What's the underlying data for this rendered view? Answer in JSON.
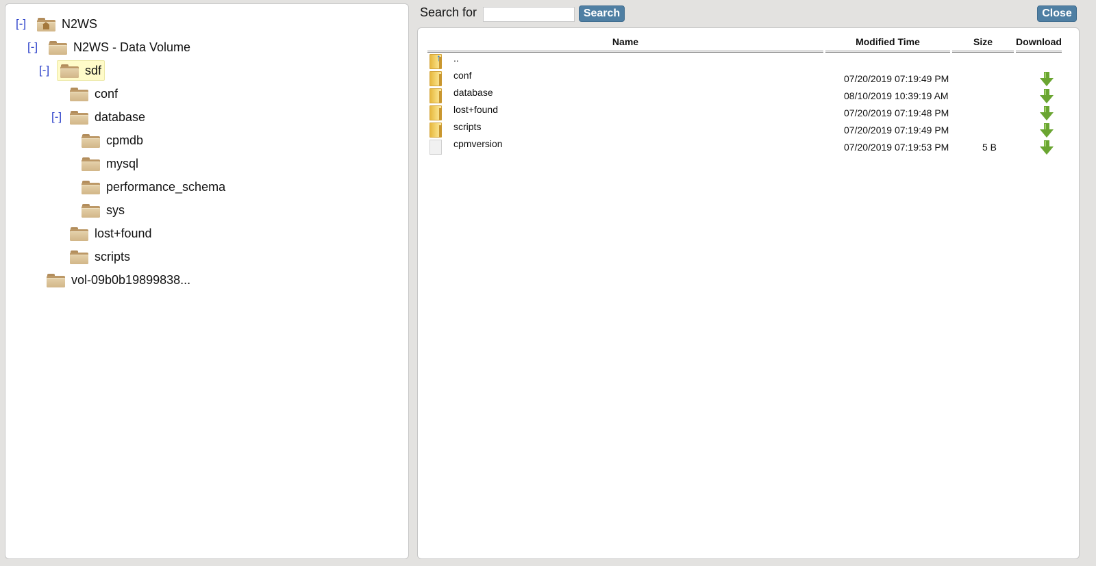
{
  "tree": {
    "nodes": [
      {
        "label": "N2WS",
        "toggle": "[-]",
        "icon": "home-folder-icon"
      },
      {
        "label": "N2WS - Data Volume",
        "toggle": "[-]",
        "icon": "folder-icon"
      },
      {
        "label": "sdf",
        "toggle": "[-]",
        "icon": "folder-icon",
        "selected": true
      },
      {
        "label": "conf",
        "icon": "folder-icon"
      },
      {
        "label": "database",
        "toggle": "[-]",
        "icon": "folder-icon"
      },
      {
        "label": "cpmdb",
        "icon": "folder-icon"
      },
      {
        "label": "mysql",
        "icon": "folder-icon"
      },
      {
        "label": "performance_schema",
        "icon": "folder-icon"
      },
      {
        "label": "sys",
        "icon": "folder-icon"
      },
      {
        "label": "lost+found",
        "icon": "folder-icon"
      },
      {
        "label": "scripts",
        "icon": "folder-icon"
      },
      {
        "label": "vol-09b0b19899838...",
        "icon": "folder-icon"
      }
    ]
  },
  "search": {
    "label": "Search for",
    "value": "",
    "button": "Search"
  },
  "close_button": "Close",
  "table": {
    "headers": {
      "name": "Name",
      "modified": "Modified Time",
      "size": "Size",
      "download": "Download"
    },
    "rows": [
      {
        "name": "..",
        "modified": "",
        "size": "",
        "type": "parent",
        "download": false
      },
      {
        "name": "conf",
        "modified": "07/20/2019 07:19:49 PM",
        "size": "",
        "type": "folder",
        "download": true
      },
      {
        "name": "database",
        "modified": "08/10/2019 10:39:19 AM",
        "size": "",
        "type": "folder",
        "download": true
      },
      {
        "name": "lost+found",
        "modified": "07/20/2019 07:19:48 PM",
        "size": "",
        "type": "folder",
        "download": true
      },
      {
        "name": "scripts",
        "modified": "07/20/2019 07:19:49 PM",
        "size": "",
        "type": "folder",
        "download": true
      },
      {
        "name": "cpmversion",
        "modified": "07/20/2019 07:19:53 PM",
        "size": "5 B",
        "type": "file",
        "download": true
      }
    ]
  },
  "colors": {
    "toggle": "#2a3fc9",
    "button": "#4f7fa3",
    "selected_node": "#fffbc9",
    "download_arrow": "#6aa531"
  }
}
